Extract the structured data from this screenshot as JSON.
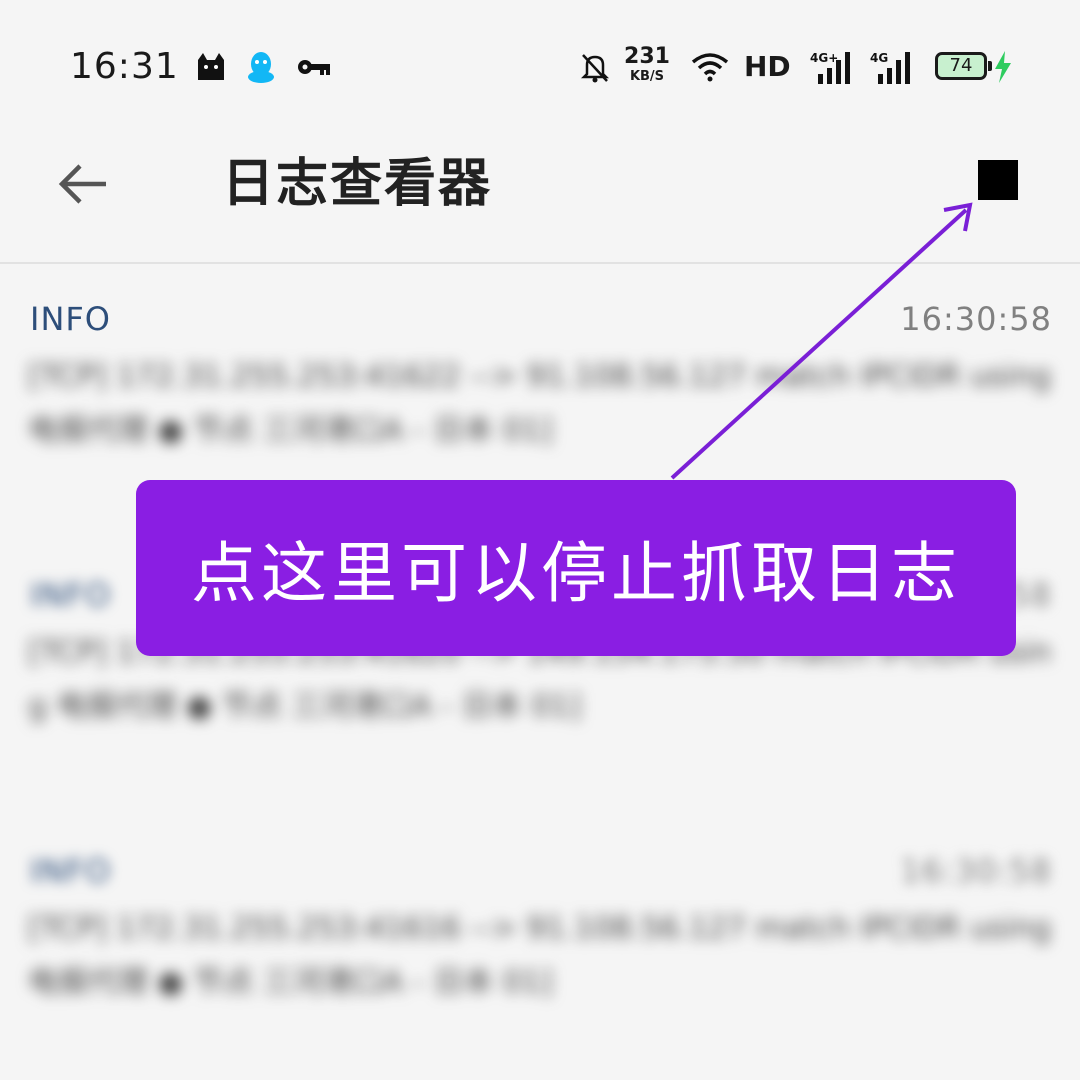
{
  "status_bar": {
    "time": "16:31",
    "net_speed_value": "231",
    "net_speed_unit": "KB/S",
    "hd_label": "HD",
    "signal1_label": "4G+",
    "signal2_label": "4G",
    "battery_level": "74",
    "icons": [
      "cat-icon",
      "qq-icon",
      "key-icon",
      "bell-off-icon",
      "wifi-icon",
      "signal-icon",
      "battery-icon",
      "charging-icon"
    ]
  },
  "app_bar": {
    "title": "日志查看器",
    "back_icon": "arrow-left-icon",
    "stop_icon": "stop-icon"
  },
  "logs": [
    {
      "level": "INFO",
      "time": "16:30:58",
      "message": "[TCP] 172.31.255.253:41622 --> 91.108.56.127 match IPCIDR using 电报代理 ● 节点 三河港口A - 日本 01]"
    },
    {
      "level": "INFO",
      "time": "16:30:58",
      "message": "[TCP] 172.31.255.253:41620 --> 149.154.175.50 match IPCIDR using 电报代理 ● 节点 三河港口A - 日本 01]"
    },
    {
      "level": "INFO",
      "time": "16:30:58",
      "message": "[TCP] 172.31.255.253:41616 --> 91.108.56.127 match IPCIDR using 电报代理 ● 节点 三河港口A - 日本 01]"
    }
  ],
  "annotation": {
    "text": "点这里可以停止抓取日志",
    "color": "#8a1ee3"
  }
}
